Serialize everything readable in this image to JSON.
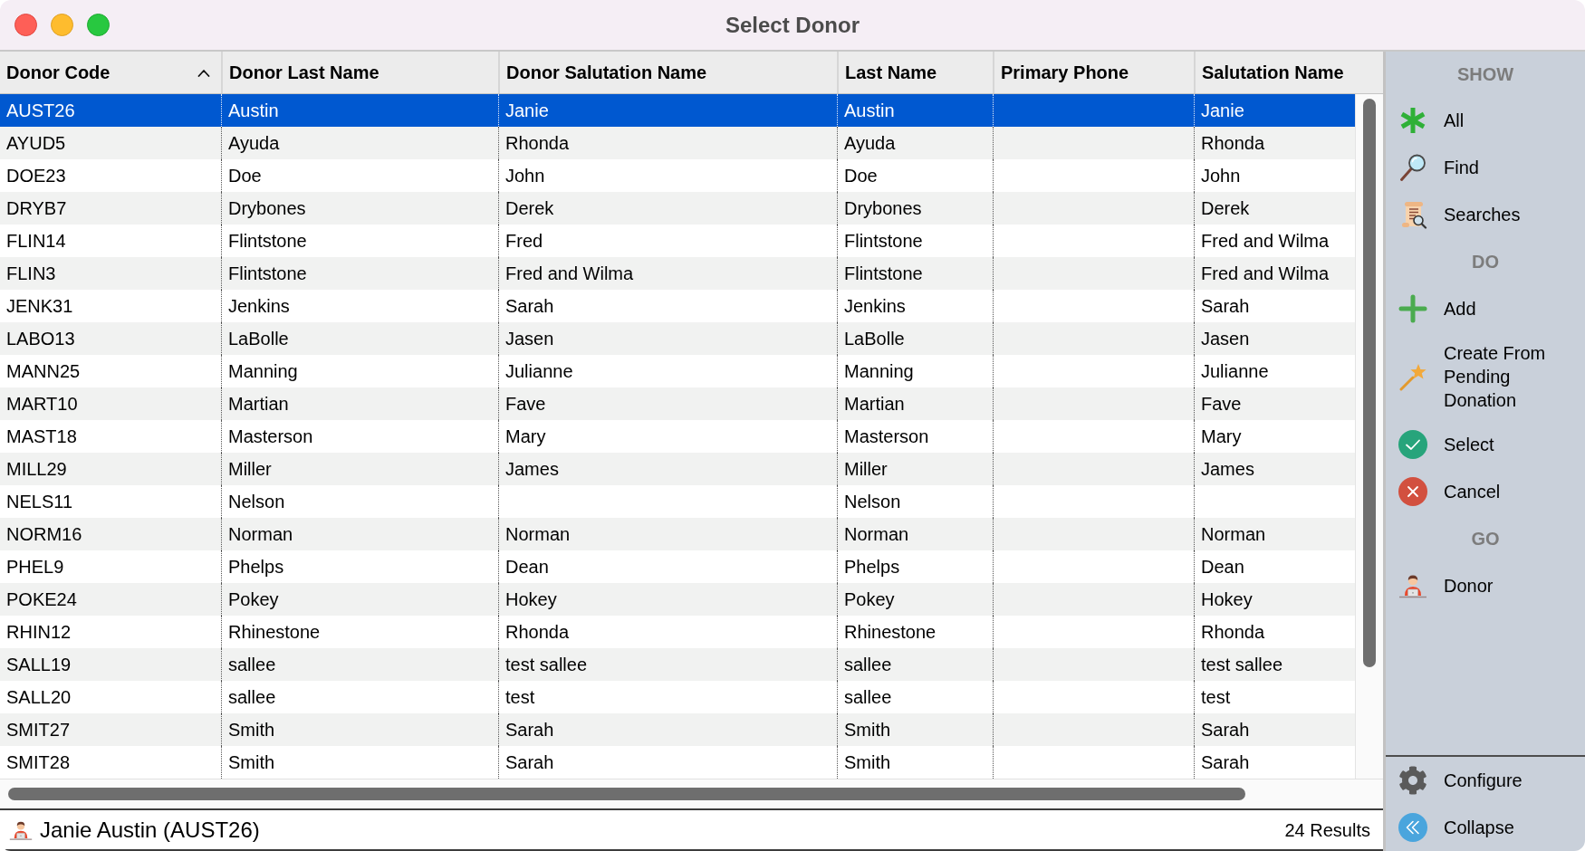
{
  "window": {
    "title": "Select Donor"
  },
  "table": {
    "columns": [
      {
        "label": "Donor Code",
        "sorted": true
      },
      {
        "label": "Donor Last Name",
        "sorted": false
      },
      {
        "label": "Donor Salutation Name",
        "sorted": false
      },
      {
        "label": "Last Name",
        "sorted": false
      },
      {
        "label": "Primary Phone",
        "sorted": false
      },
      {
        "label": "Salutation Name",
        "sorted": false
      }
    ],
    "rows": [
      {
        "selected": true,
        "donor_code": "AUST26",
        "donor_last_name": "Austin",
        "donor_salutation_name": "Janie",
        "last_name": "Austin",
        "salutation_name": "Janie"
      },
      {
        "selected": false,
        "donor_code": "AYUD5",
        "donor_last_name": "Ayuda",
        "donor_salutation_name": "Rhonda",
        "last_name": "Ayuda",
        "salutation_name": "Rhonda"
      },
      {
        "selected": false,
        "donor_code": "DOE23",
        "donor_last_name": "Doe",
        "donor_salutation_name": "John",
        "last_name": "Doe",
        "salutation_name": "John"
      },
      {
        "selected": false,
        "donor_code": "DRYB7",
        "donor_last_name": "Drybones",
        "donor_salutation_name": "Derek",
        "last_name": "Drybones",
        "salutation_name": "Derek"
      },
      {
        "selected": false,
        "donor_code": "FLIN14",
        "donor_last_name": "Flintstone",
        "donor_salutation_name": "Fred",
        "last_name": "Flintstone",
        "salutation_name": "Fred and Wilma"
      },
      {
        "selected": false,
        "donor_code": "FLIN3",
        "donor_last_name": "Flintstone",
        "donor_salutation_name": "Fred and Wilma",
        "last_name": "Flintstone",
        "salutation_name": "Fred and Wilma"
      },
      {
        "selected": false,
        "donor_code": "JENK31",
        "donor_last_name": "Jenkins",
        "donor_salutation_name": "Sarah",
        "last_name": "Jenkins",
        "salutation_name": "Sarah"
      },
      {
        "selected": false,
        "donor_code": "LABO13",
        "donor_last_name": "LaBolle",
        "donor_salutation_name": "Jasen",
        "last_name": "LaBolle",
        "salutation_name": "Jasen"
      },
      {
        "selected": false,
        "donor_code": "MANN25",
        "donor_last_name": "Manning",
        "donor_salutation_name": "Julianne",
        "last_name": "Manning",
        "salutation_name": "Julianne"
      },
      {
        "selected": false,
        "donor_code": "MART10",
        "donor_last_name": "Martian",
        "donor_salutation_name": "Fave",
        "last_name": "Martian",
        "salutation_name": "Fave"
      },
      {
        "selected": false,
        "donor_code": "MAST18",
        "donor_last_name": "Masterson",
        "donor_salutation_name": "Mary",
        "last_name": "Masterson",
        "salutation_name": "Mary"
      },
      {
        "selected": false,
        "donor_code": "MILL29",
        "donor_last_name": "Miller",
        "donor_salutation_name": "James",
        "last_name": "Miller",
        "salutation_name": "James"
      },
      {
        "selected": false,
        "donor_code": "NELS11",
        "donor_last_name": "Nelson",
        "last_name": "Nelson"
      },
      {
        "selected": false,
        "donor_code": "NORM16",
        "donor_last_name": "Norman",
        "donor_salutation_name": "Norman",
        "last_name": "Norman",
        "salutation_name": "Norman"
      },
      {
        "selected": false,
        "donor_code": "PHEL9",
        "donor_last_name": "Phelps",
        "donor_salutation_name": "Dean",
        "last_name": "Phelps",
        "salutation_name": "Dean"
      },
      {
        "selected": false,
        "donor_code": "POKE24",
        "donor_last_name": "Pokey",
        "donor_salutation_name": "Hokey",
        "last_name": "Pokey",
        "salutation_name": "Hokey"
      },
      {
        "selected": false,
        "donor_code": "RHIN12",
        "donor_last_name": "Rhinestone",
        "donor_salutation_name": "Rhonda",
        "last_name": "Rhinestone",
        "salutation_name": "Rhonda"
      },
      {
        "selected": false,
        "donor_code": "SALL19",
        "donor_last_name": "sallee",
        "donor_salutation_name": "test sallee",
        "last_name": "sallee",
        "salutation_name": "test sallee"
      },
      {
        "selected": false,
        "donor_code": "SALL20",
        "donor_last_name": "sallee",
        "donor_salutation_name": "test",
        "last_name": "sallee",
        "salutation_name": "test"
      },
      {
        "selected": false,
        "donor_code": "SMIT27",
        "donor_last_name": "Smith",
        "donor_salutation_name": "Sarah",
        "last_name": "Smith",
        "salutation_name": "Sarah"
      },
      {
        "selected": false,
        "donor_code": "SMIT28",
        "donor_last_name": "Smith",
        "donor_salutation_name": "Sarah",
        "last_name": "Smith",
        "salutation_name": "Sarah"
      }
    ]
  },
  "sidebar": {
    "sections": [
      {
        "heading": "SHOW",
        "items": [
          {
            "kind": "all",
            "label": "All"
          },
          {
            "kind": "find",
            "label": "Find"
          },
          {
            "kind": "searches",
            "label": "Searches"
          }
        ]
      },
      {
        "heading": "DO",
        "items": [
          {
            "kind": "add",
            "label": "Add"
          },
          {
            "kind": "wizard",
            "label": "Create From Pending Donation"
          },
          {
            "kind": "select",
            "label": "Select"
          },
          {
            "kind": "cancel",
            "label": "Cancel"
          }
        ]
      },
      {
        "heading": "GO",
        "items": [
          {
            "kind": "donor",
            "label": "Donor"
          }
        ]
      }
    ],
    "footer_items": [
      {
        "kind": "configure",
        "label": "Configure"
      },
      {
        "kind": "collapse",
        "label": "Collapse"
      }
    ]
  },
  "status_bar": {
    "selection": "Janie Austin (AUST26)",
    "result_count": "24 Results"
  }
}
